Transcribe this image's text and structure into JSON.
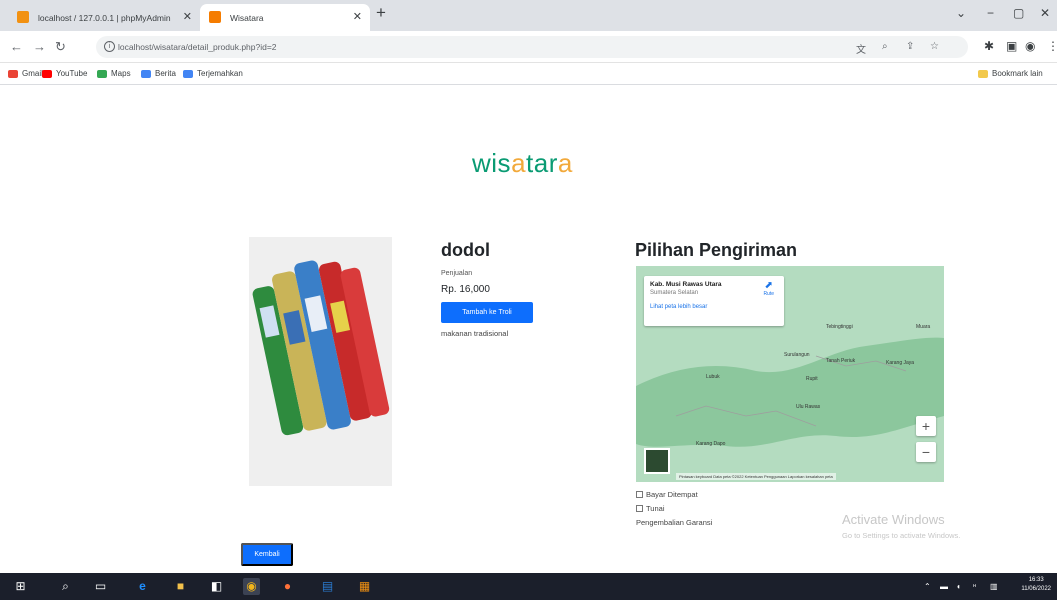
{
  "browser": {
    "tabs": [
      {
        "label": "localhost / 127.0.0.1 | phpMyAdmin"
      },
      {
        "label": "Wisatara"
      }
    ],
    "url": "localhost/wisatara/detail_produk.php?id=2",
    "bookmarks": [
      {
        "label": "Gmail",
        "color": "#ea4335"
      },
      {
        "label": "YouTube",
        "color": "#ff0000"
      },
      {
        "label": "Maps",
        "color": "#34a853"
      },
      {
        "label": "Berita",
        "color": "#4285f4"
      },
      {
        "label": "Terjemahkan",
        "color": "#4285f4"
      }
    ],
    "other_bookmarks": "Bookmark lain"
  },
  "page": {
    "logo": {
      "part1": "wis",
      "part2": "a",
      "part3": "tar",
      "part4": "a"
    },
    "product": {
      "name": "dodol",
      "price_label": "Penjualan",
      "price": "Rp. 16,000",
      "cart_button": "Tambah ke Troli",
      "description": "makanan tradisional"
    },
    "shipping": {
      "title": "Pilihan Pengiriman",
      "map": {
        "place_name": "Kab. Musi Rawas Utara",
        "place_sub": "Sumatera Selatan",
        "directions": "Rute",
        "larger_map": "Lihat peta lebih besar",
        "towns": [
          "Tebingtinggi",
          "Surulangun",
          "Tanah Periuk",
          "Karang Jaya",
          "Rupit",
          "Lubuk",
          "Muara",
          "Ulu Rawas",
          "Karang Dapo"
        ],
        "attribution": "Pintasan keyboard   Data peta ©2022   Ketentuan Penggunaan   Laporkan kesalahan peta",
        "zoom_in": "+",
        "zoom_out": "−"
      },
      "options": [
        "Bayar Ditempat",
        "Tunai"
      ],
      "return": "Pengembalian Garansi"
    },
    "back_button": "Kembali",
    "watermark": {
      "title": "Activate Windows",
      "subtitle": "Go to Settings to activate Windows."
    }
  },
  "taskbar": {
    "clock_time": "16:33",
    "clock_date": "11/06/2022"
  }
}
